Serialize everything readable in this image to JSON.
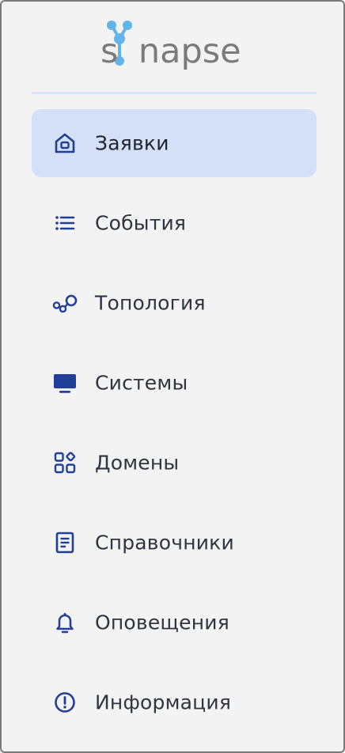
{
  "brand": {
    "logo_text": "synapse",
    "text_color": "#7b7b7b",
    "accent": "#61b5e8"
  },
  "colors": {
    "icon": "#213f97",
    "active_bg": "#d4e0f8",
    "divider": "#dbe5fb"
  },
  "menu": {
    "items": [
      {
        "label": "Заявки",
        "icon": "home-icon",
        "active": true
      },
      {
        "label": "События",
        "icon": "list-icon",
        "active": false
      },
      {
        "label": "Топология",
        "icon": "topology-icon",
        "active": false
      },
      {
        "label": "Системы",
        "icon": "monitor-icon",
        "active": false
      },
      {
        "label": "Домены",
        "icon": "apps-icon",
        "active": false
      },
      {
        "label": "Справочники",
        "icon": "document-icon",
        "active": false
      },
      {
        "label": "Оповещения",
        "icon": "bell-icon",
        "active": false
      },
      {
        "label": "Информация",
        "icon": "info-icon",
        "active": false
      }
    ]
  }
}
